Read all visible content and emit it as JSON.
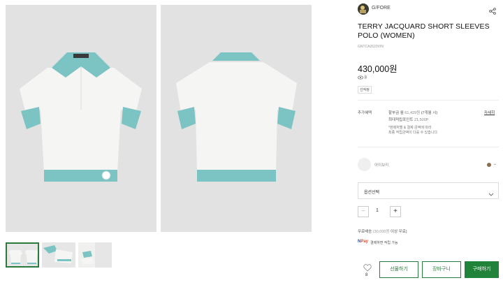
{
  "brand": {
    "name": "G/FORE"
  },
  "product": {
    "title": "TERRY JACQUARD SHORT SLEEVES POLO (WOMEN)",
    "code": "GNTCA2620VIN",
    "price": "430,000원",
    "stock_count": "8",
    "tag": "선적정"
  },
  "benefits": {
    "label": "추가혜택",
    "line1_prefix": "할부금 월 ",
    "line1_value": "61,429원",
    "line1_suffix": " (7개월 시)",
    "line2_prefix": "최대적립포인트 ",
    "line2_value": "21,500P",
    "note1": "*판매처별 & 결제 금액에 따라",
    "note2": "최종 적립금액이 다를 수 있습니다.",
    "detail_link": "자세히"
  },
  "color": {
    "selected_name": "아이보리",
    "dot_color": "#8b6e4e"
  },
  "option_select": {
    "placeholder": "옵션선택"
  },
  "quantity": {
    "minus": "−",
    "value": "1",
    "plus": "+"
  },
  "shipping": {
    "prefix": "무료배송 ",
    "value": "(30,000원",
    "suffix": " 이상 무료)"
  },
  "payment": {
    "logo_a": "N",
    "logo_b": "Pay",
    "text": "결제하면 적립 가능"
  },
  "wishlist": {
    "count": "8"
  },
  "actions": {
    "gift": "선물하기",
    "cart": "장바구니",
    "buy": "구매하기"
  },
  "colors": {
    "accent_green": "#21823a",
    "polo_trim": "#7cc3c3",
    "polo_body": "#f5f5f3",
    "photo_bg": "#e2e2e2"
  }
}
